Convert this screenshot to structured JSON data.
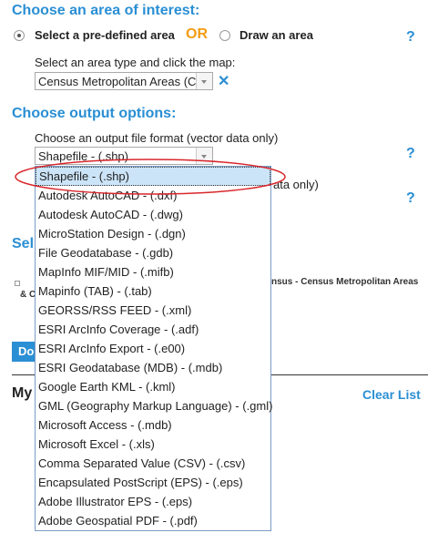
{
  "area": {
    "title": "Choose an area of interest:",
    "predefined_label": "Select a pre-defined area",
    "or_label": "OR",
    "draw_label": "Draw an area",
    "type_label": "Select an area type and click the map:",
    "type_value": "Census Metropolitan Areas (C",
    "clear_icon": "close-icon",
    "help": "?"
  },
  "output": {
    "title": "Choose output options:",
    "format_label": "Choose an output file format (vector data only)",
    "format_value": "Shapefile - (.shp)",
    "behind_label": "ata only)",
    "help1": "?",
    "help2": "?",
    "options": [
      "Shapefile - (.shp)",
      "Autodesk AutoCAD - (.dxf)",
      "Autodesk AutoCAD - (.dwg)",
      "MicroStation Design - (.dgn)",
      "File Geodatabase - (.gdb)",
      "MapInfo MIF/MID - (.mifb)",
      "Mapinfo (TAB) - (.tab)",
      "GEORSS/RSS FEED - (.xml)",
      "ESRI ArcInfo Coverage - (.adf)",
      "ESRI ArcInfo Export - (.e00)",
      "ESRI Geodatabase (MDB) - (.mdb)",
      "Google Earth KML - (.kml)",
      "GML (Geography Markup Language) - (.gml)",
      "Microsoft Access - (.mdb)",
      "Microsoft Excel - (.xls)",
      "Comma Separated Value (CSV) - (.csv)",
      "Encapsulated PostScript (EPS) - (.eps)",
      "Adobe Illustrator EPS - (.eps)",
      "Adobe Geospatial PDF - (.pdf)"
    ],
    "selected_index": 0
  },
  "behind": {
    "sel_fragment": "Sel",
    "census_text": "nsus - Census Metropolitan Areas",
    "amp_fragment": "& C",
    "do_button": "Do",
    "my_fragment": "My",
    "clear_list": "Clear List"
  },
  "colors": {
    "accent": "#2a8fd4",
    "or_orange": "#f39c12",
    "annotation_red": "#d9262b",
    "selected_bg": "#cce4f7"
  }
}
